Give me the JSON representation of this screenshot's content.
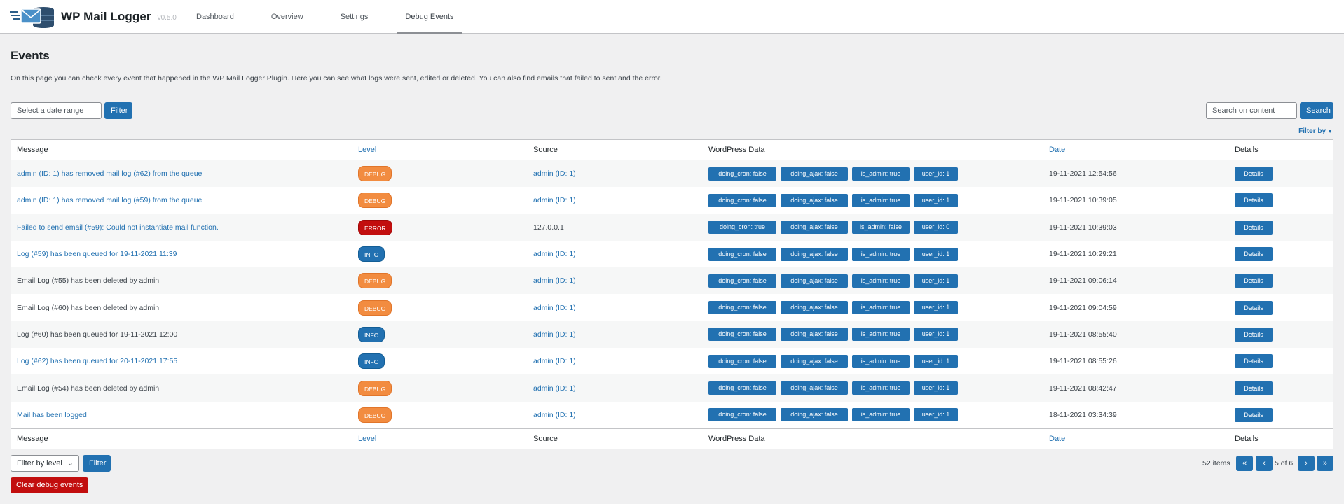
{
  "app": {
    "name": "WP Mail Logger",
    "version": "v0.5.0"
  },
  "nav": {
    "tabs": [
      {
        "label": "Dashboard",
        "active": false
      },
      {
        "label": "Overview",
        "active": false
      },
      {
        "label": "Settings",
        "active": false
      },
      {
        "label": "Debug Events",
        "active": true
      }
    ]
  },
  "page": {
    "title": "Events",
    "description": "On this page you can check every event that happened in the WP Mail Logger Plugin. Here you can see what logs were sent, edited or deleted. You can also find emails that failed to sent and the error."
  },
  "toolbar": {
    "date_placeholder": "Select a date range",
    "filter_label": "Filter",
    "search_placeholder": "Search on content",
    "search_label": "Search",
    "filter_by_label": "Filter by"
  },
  "table": {
    "columns": {
      "message": "Message",
      "level": "Level",
      "source": "Source",
      "wordpress_data": "WordPress Data",
      "date": "Date",
      "details": "Details"
    },
    "details_label": "Details",
    "rows": [
      {
        "message": "admin (ID: 1) has removed mail log (#62) from the queue",
        "message_link": true,
        "level": "DEBUG",
        "source": "admin (ID: 1)",
        "source_link": true,
        "wp": [
          "doing_cron: false",
          "doing_ajax: false",
          "is_admin: true",
          "user_id: 1"
        ],
        "date": "19-11-2021 12:54:56"
      },
      {
        "message": "admin (ID: 1) has removed mail log (#59) from the queue",
        "message_link": true,
        "level": "DEBUG",
        "source": "admin (ID: 1)",
        "source_link": true,
        "wp": [
          "doing_cron: false",
          "doing_ajax: false",
          "is_admin: true",
          "user_id: 1"
        ],
        "date": "19-11-2021 10:39:05"
      },
      {
        "message": "Failed to send email (#59): Could not instantiate mail function.",
        "message_link": true,
        "level": "ERROR",
        "source": "127.0.0.1",
        "source_link": false,
        "wp": [
          "doing_cron: true",
          "doing_ajax: false",
          "is_admin: false",
          "user_id: 0"
        ],
        "date": "19-11-2021 10:39:03"
      },
      {
        "message": "Log (#59) has been queued for 19-11-2021 11:39",
        "message_link": true,
        "level": "INFO",
        "source": "admin (ID: 1)",
        "source_link": true,
        "wp": [
          "doing_cron: false",
          "doing_ajax: false",
          "is_admin: true",
          "user_id: 1"
        ],
        "date": "19-11-2021 10:29:21"
      },
      {
        "message": "Email Log (#55) has been deleted by admin",
        "message_link": false,
        "level": "DEBUG",
        "source": "admin (ID: 1)",
        "source_link": true,
        "wp": [
          "doing_cron: false",
          "doing_ajax: false",
          "is_admin: true",
          "user_id: 1"
        ],
        "date": "19-11-2021 09:06:14"
      },
      {
        "message": "Email Log (#60) has been deleted by admin",
        "message_link": false,
        "level": "DEBUG",
        "source": "admin (ID: 1)",
        "source_link": true,
        "wp": [
          "doing_cron: false",
          "doing_ajax: false",
          "is_admin: true",
          "user_id: 1"
        ],
        "date": "19-11-2021 09:04:59"
      },
      {
        "message": "Log (#60) has been queued for 19-11-2021 12:00",
        "message_link": false,
        "level": "INFO",
        "source": "admin (ID: 1)",
        "source_link": true,
        "wp": [
          "doing_cron: false",
          "doing_ajax: false",
          "is_admin: true",
          "user_id: 1"
        ],
        "date": "19-11-2021 08:55:40"
      },
      {
        "message": "Log (#62) has been queued for 20-11-2021 17:55",
        "message_link": true,
        "level": "INFO",
        "source": "admin (ID: 1)",
        "source_link": true,
        "wp": [
          "doing_cron: false",
          "doing_ajax: false",
          "is_admin: true",
          "user_id: 1"
        ],
        "date": "19-11-2021 08:55:26"
      },
      {
        "message": "Email Log (#54) has been deleted by admin",
        "message_link": false,
        "level": "DEBUG",
        "source": "admin (ID: 1)",
        "source_link": true,
        "wp": [
          "doing_cron: false",
          "doing_ajax: false",
          "is_admin: true",
          "user_id: 1"
        ],
        "date": "19-11-2021 08:42:47"
      },
      {
        "message": "Mail has been logged",
        "message_link": true,
        "level": "DEBUG",
        "source": "admin (ID: 1)",
        "source_link": true,
        "wp": [
          "doing_cron: false",
          "doing_ajax: false",
          "is_admin: true",
          "user_id: 1"
        ],
        "date": "18-11-2021 03:34:39"
      }
    ]
  },
  "bottom": {
    "level_select_value": "Filter by level",
    "filter_label": "Filter",
    "clear_label": "Clear debug events"
  },
  "pagination": {
    "count": "52 items",
    "first": "«",
    "prev": "‹",
    "page": "5 of 6",
    "next": "›",
    "last": "»"
  },
  "colors": {
    "accent": "#2271b1",
    "debug": "#f28c40",
    "error": "#c20e0e",
    "background": "#f0f0f1"
  }
}
